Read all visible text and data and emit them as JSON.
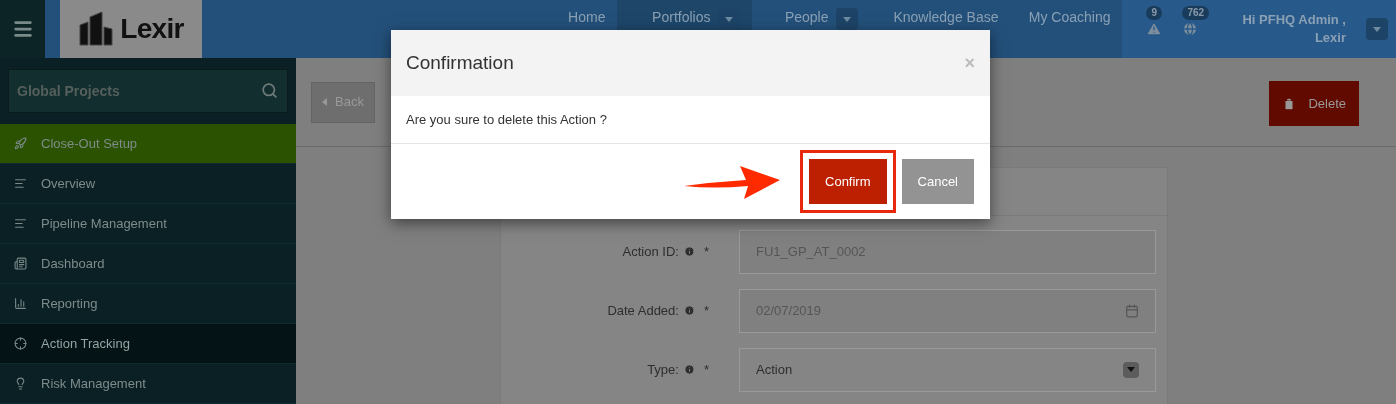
{
  "header": {
    "logo": "Lexir",
    "nav": [
      {
        "label": "Home",
        "selected": false,
        "has_dropdown": false
      },
      {
        "label": "Portfolios",
        "selected": true,
        "has_dropdown": true
      },
      {
        "label": "People",
        "selected": false,
        "has_dropdown": true
      },
      {
        "label": "Knowledge Base",
        "selected": false,
        "has_dropdown": false
      },
      {
        "label": "My Coaching",
        "selected": false,
        "has_dropdown": false
      }
    ],
    "notifications": [
      {
        "kind": "warning",
        "count": "9"
      },
      {
        "kind": "globe",
        "count": "762"
      }
    ],
    "user": {
      "greeting": "Hi PFHQ Admin ,",
      "name": "Lexir"
    }
  },
  "sidebar": {
    "search": {
      "placeholder": "Global Projects"
    },
    "items": [
      {
        "label": "Close-Out Setup",
        "kind": "rocket",
        "selected": true,
        "hovered": false
      },
      {
        "label": "Overview",
        "kind": "lines",
        "selected": false,
        "hovered": false
      },
      {
        "label": "Pipeline Management",
        "kind": "lines",
        "selected": false,
        "hovered": false
      },
      {
        "label": "Dashboard",
        "kind": "newspaper",
        "selected": false,
        "hovered": false
      },
      {
        "label": "Reporting",
        "kind": "chart",
        "selected": false,
        "hovered": false
      },
      {
        "label": "Action Tracking",
        "kind": "crosshair",
        "selected": false,
        "hovered": true
      },
      {
        "label": "Risk Management",
        "kind": "bulb",
        "selected": false,
        "hovered": false
      }
    ]
  },
  "toolbar": {
    "back": "Back",
    "delete": "Delete"
  },
  "form": {
    "fields": [
      {
        "label": "Action ID:",
        "required_mark": "*",
        "kind": "text",
        "value": "FU1_GP_AT_0002"
      },
      {
        "label": "Date Added:",
        "required_mark": "*",
        "kind": "date",
        "value": "02/07/2019"
      },
      {
        "label": "Type:",
        "required_mark": "*",
        "kind": "select",
        "value": "Action"
      }
    ]
  },
  "modal": {
    "title": "Confirmation",
    "close": "×",
    "message": "Are you sure to delete this Action ?",
    "buttons": [
      {
        "label": "Confirm",
        "kind": "primary",
        "highlighted": true
      },
      {
        "label": "Cancel",
        "kind": "secondary",
        "highlighted": false
      }
    ]
  }
}
